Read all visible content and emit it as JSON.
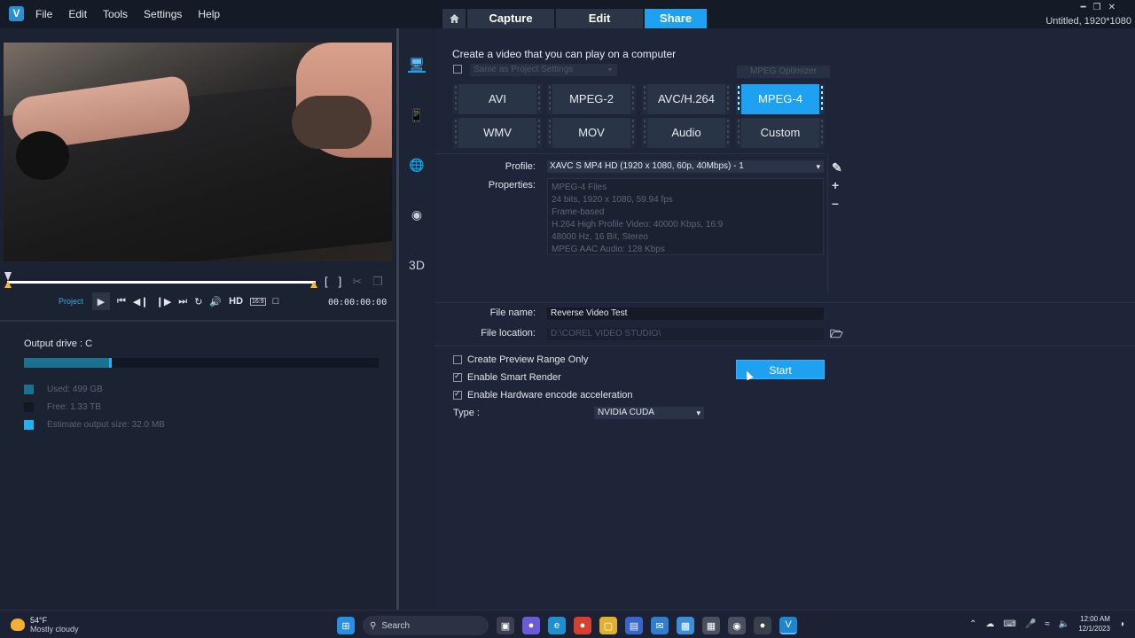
{
  "menu": [
    "File",
    "Edit",
    "Tools",
    "Settings",
    "Help"
  ],
  "mode_tabs": [
    "Capture",
    "Edit",
    "Share"
  ],
  "window": {
    "project_title": "Untitled, 1920*1080"
  },
  "player": {
    "project_label": "Project",
    "hd_label": "HD",
    "ratio_label": "16:9",
    "timecode": "00:00:00:00"
  },
  "drive": {
    "label": "Output drive : C",
    "used_fraction": 0.24,
    "estimate_fraction": 0.24,
    "legend": [
      {
        "label": "Used:  499 GB",
        "color": "#1a7190"
      },
      {
        "label": "Free:  1.33 TB",
        "color": "#111824"
      },
      {
        "label": "Estimate output size:  32.0 MB",
        "color": "#22b0f3"
      }
    ]
  },
  "share": {
    "heading": "Create a video that you can play on a computer",
    "same_as_project": "Same as Project Settings",
    "mpeg_optimizer": "MPEG Optimizer",
    "formats": [
      "AVI",
      "MPEG-2",
      "AVC/H.264",
      "MPEG-4",
      "WMV",
      "MOV",
      "Audio",
      "Custom"
    ],
    "active_format": "MPEG-4",
    "profile_label": "Profile:",
    "profile_value": "XAVC S MP4 HD (1920 x 1080, 60p, 40Mbps) - 1",
    "properties_label": "Properties:",
    "properties": [
      "MPEG-4 Files",
      "24 bits, 1920 x 1080, 59.94 fps",
      "Frame-based",
      "H.264 High Profile Video: 40000 Kbps, 16:9",
      "48000 Hz, 16 Bit, Stereo",
      "MPEG AAC Audio: 128 Kbps"
    ],
    "file_name_label": "File name:",
    "file_name": "Reverse Video Test",
    "file_location_label": "File location:",
    "file_location": "D:\\COREL VIDEO STUDIO\\",
    "options": [
      {
        "label": "Create Preview Range Only",
        "checked": false
      },
      {
        "label": "Enable Smart Render",
        "checked": true
      },
      {
        "label": "Enable Hardware encode acceleration",
        "checked": true
      }
    ],
    "type_label": "Type :",
    "type_value": "NVIDIA CUDA",
    "start_label": "Start"
  },
  "taskbar": {
    "temp": "54°F",
    "weather": "Mostly cloudy",
    "search_placeholder": "Search",
    "time": "12:00 AM",
    "date": "12/1/2023"
  }
}
